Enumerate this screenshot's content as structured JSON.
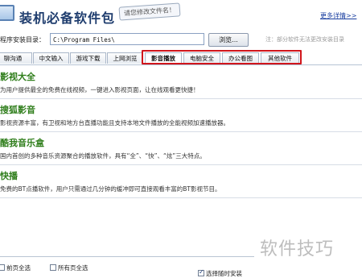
{
  "header": {
    "title": "装机必备软件包",
    "edit_badge": "请您修改文件名！",
    "more_link": "更多详情>>"
  },
  "path": {
    "label": "程序安装目录：",
    "value": "C:\\Program Files\\",
    "browse_label": "浏览...",
    "note": "注：部分软件无法更改安装目录"
  },
  "tabs": [
    {
      "label": "聊沟通"
    },
    {
      "label": "中文输入"
    },
    {
      "label": "游戏下载"
    },
    {
      "label": "上网浏览"
    },
    {
      "label": "影音播放"
    },
    {
      "label": "电脑安全"
    },
    {
      "label": "办公看图"
    },
    {
      "label": "其他软件"
    }
  ],
  "items": [
    {
      "title": "影视大全",
      "desc": "为用户提供最全的免费在线视频，一键进入影视页面，让在线观看更快捷！"
    },
    {
      "title": "搜狐影音",
      "desc": "影视资源丰富，有卫视和地方台直播功能且支持本地文件播放的全能视频加速播放器。"
    },
    {
      "title": "酷我音乐盒",
      "desc": "国内首创的多种音乐资源聚合的播放软件，具有“全”、“快”、“炫”三大特点。"
    },
    {
      "title": "快播",
      "desc": "免费的BT点播软件，用户只需通过几分钟的缓冲即可直接观看丰富的BT影视节目。"
    }
  ],
  "footer": {
    "current_page_all": "前页全选",
    "all_pages_all": "所有页全选",
    "install_label": "选择随时安装"
  },
  "watermark": "软件技巧"
}
